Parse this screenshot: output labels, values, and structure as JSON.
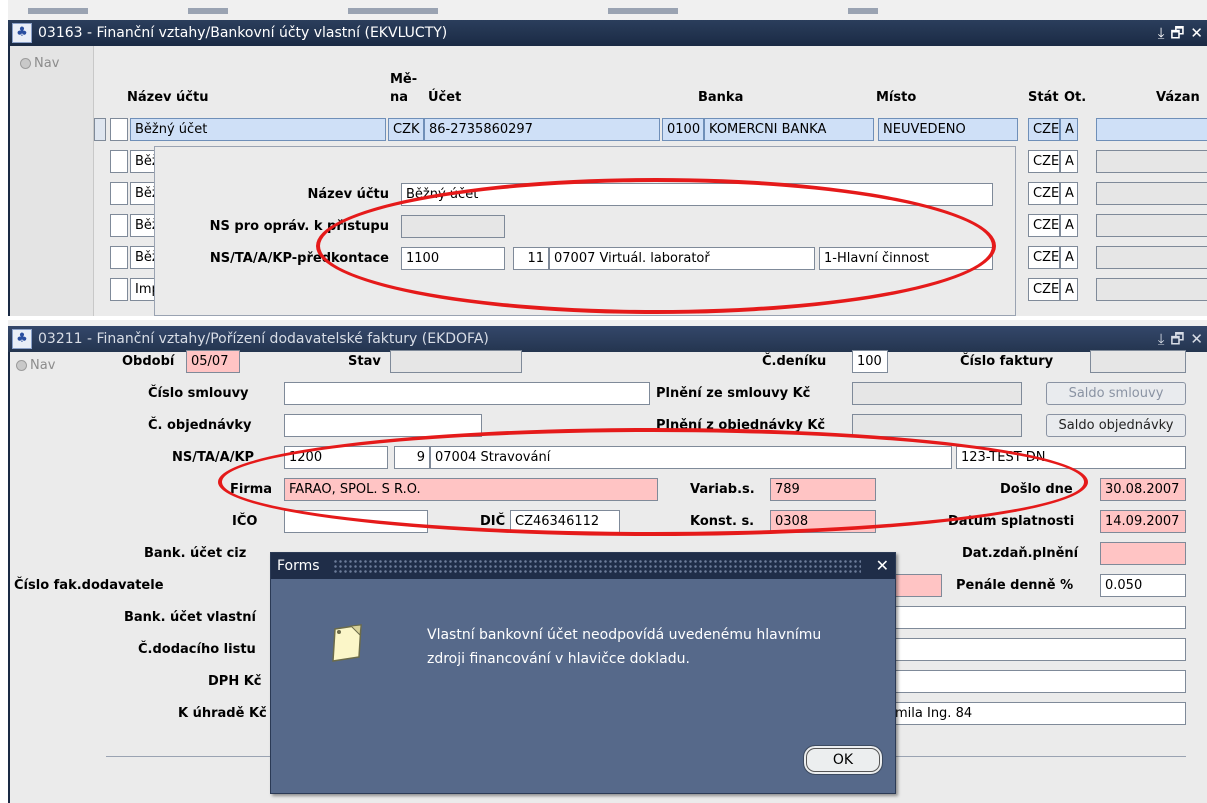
{
  "screen1": {
    "title": "03163 - Finanční vztahy/Bankovní účty vlastní (EKVLUCTY)",
    "nav_label": "Nav",
    "window_controls": [
      "⤓",
      "🗗",
      "✕"
    ],
    "columns": {
      "nazev": "Název účtu",
      "mena_top": "Mě-",
      "mena_bottom": "na",
      "ucet": "Účet",
      "banka": "Banka",
      "misto": "Místo",
      "stat": "Stát",
      "ot": "Ot.",
      "vazan": "Vázan"
    },
    "first_row": {
      "nazev": "Běžný účet",
      "mena": "CZK",
      "ucet": "86-2735860297",
      "banka_kod": "0100",
      "banka": "KOMERCNI BANKA",
      "misto": "NEUVEDENO",
      "stat": "CZE",
      "ot": "A"
    },
    "rows": [
      {
        "nazev": "Běž",
        "stat": "CZE",
        "ot": "A"
      },
      {
        "nazev": "Běž",
        "stat": "CZE",
        "ot": "A"
      },
      {
        "nazev": "Běž",
        "stat": "CZE",
        "ot": "A"
      },
      {
        "nazev": "Běž",
        "stat": "CZE",
        "ot": "A"
      },
      {
        "nazev": "Imp",
        "stat": "CZE",
        "ot": "A"
      }
    ],
    "popup": {
      "nazev_label": "Název účtu",
      "nazev_value": "Běžný účet",
      "ns_label": "NS pro opráv. k přístupu",
      "ns_value": "",
      "predkontace_label": "NS/TA/A/KP-předkontace",
      "ns_code": "1100",
      "ta_code": "11",
      "activity": "07007 Virtuál. laboratoř",
      "kp": "1-Hlavní činnost"
    }
  },
  "screen2": {
    "title": "03211 - Finanční vztahy/Pořízení dodavatelské faktury (EKDOFA)",
    "nav_label": "Nav",
    "window_controls": [
      "⤓",
      "🗗",
      "✕"
    ],
    "obdobi_label": "Období",
    "obdobi_value": "05/07",
    "stav_label": "Stav",
    "stav_value": "",
    "cdeniku_label": "Č.deníku",
    "cdeniku_value": "100",
    "cislo_faktury_label": "Číslo faktury",
    "cislo_faktury_value": "",
    "cislo_smlouvy_label": "Číslo smlouvy",
    "cislo_smlouvy_value": "",
    "plneni_smlouvy_label": "Plnění ze smlouvy Kč",
    "plneni_smlouvy_value": "",
    "saldo_smlouvy_button": "Saldo smlouvy",
    "c_objednavky_label": "Č. objednávky",
    "c_objednavky_value": "",
    "plneni_objednavky_label": "Plnění z objednávky Kč",
    "plneni_objednavky_value": "",
    "saldo_objednavky_button": "Saldo objednávky",
    "ns_ta_label": "NS/TA/A/KP",
    "ns_code": "1200",
    "ta_code": "9",
    "activity": "07004 Stravování",
    "kp": "123-TEST DN",
    "firma_label": "Firma",
    "firma_value": "FARAO, SPOL. S R.O.",
    "variab_label": "Variab.s.",
    "variab_value": "789",
    "doslo_label": "Došlo dne",
    "doslo_value": "30.08.2007",
    "ico_label": "IČO",
    "ico_value": "",
    "dic_label": "DIČ",
    "dic_value": "CZ46346112",
    "konst_label": "Konst. s.",
    "konst_value": "0308",
    "splatnost_label": "Datum splatnosti",
    "splatnost_value": "14.09.2007",
    "bank_ucet_ciz_label": "Bank. účet ciz",
    "dat_zdan_label": "Dat.zdaň.plnění",
    "dat_zdan_value": "",
    "cislo_fak_dod_label": "Číslo fak.dodavatele",
    "penale_label": "Penále denně %",
    "penale_value": "0.050",
    "bank_ucet_vlastni_label": "Bank. účet vlastní",
    "c_dodaciho_listu_label": "Č.dodacího listu",
    "dph_label": "DPH Kč",
    "k_uhrade_label": "K úhradě Kč",
    "k_uhrade_extra": "mila Ing. 84"
  },
  "dialog": {
    "title": "Forms",
    "message_line1": "Vlastní bankovní účet neodpovídá uvedenému hlavnímu",
    "message_line2": "zdroji financování v hlavičce dokladu.",
    "ok_label": "OK",
    "icon": "note-icon"
  },
  "colors": {
    "titlebar": "#1f2d48",
    "field_required": "#ffc4c4",
    "highlight_ellipse": "#e51a1a",
    "dialog_bg": "#56698a",
    "selected_row": "#cfe0f7"
  }
}
